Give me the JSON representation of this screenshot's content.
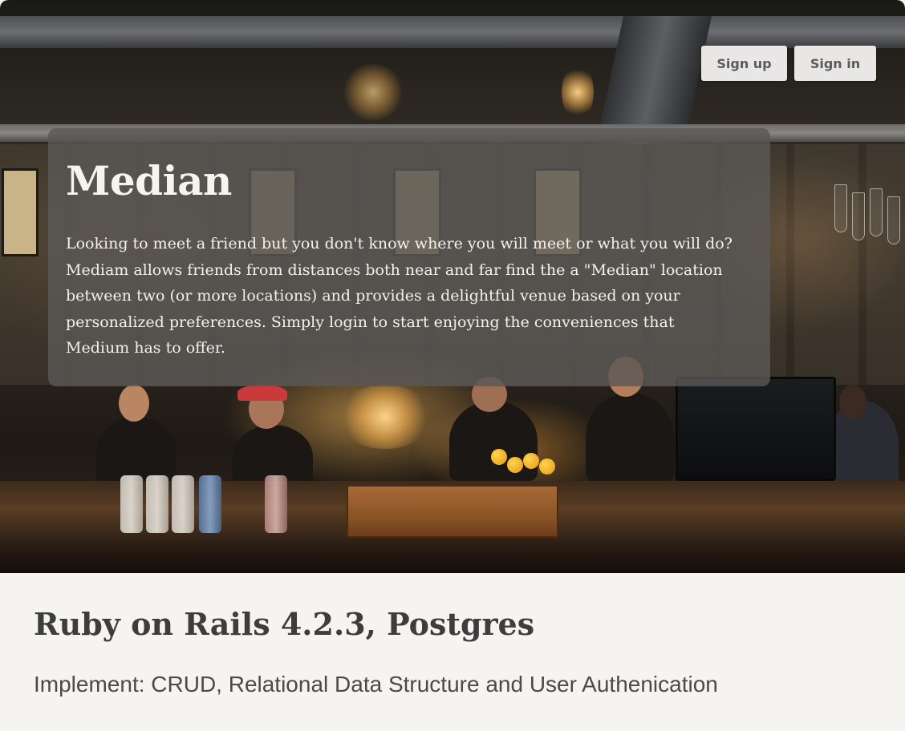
{
  "header": {
    "signup_label": "Sign up",
    "signin_label": "Sign in"
  },
  "hero": {
    "title": "Median",
    "description": "Looking to meet a friend but you don't know where you will meet or what you will do? Mediam allows friends from distances both near and far find the a \"Median\" location between two (or more locations) and provides a delightful venue based on your personalized preferences. Simply login to start enjoying the conveniences that Medium has to offer."
  },
  "caption": {
    "title": "Ruby on Rails 4.2.3, Postgres",
    "subtitle": "Implement: CRUD, Relational Data Structure and User Authenication"
  },
  "colors": {
    "button_bg": "#e8e7e5",
    "button_text": "#5a5b5e",
    "panel_bg": "#5a5855",
    "page_bg": "#f5f4f1",
    "caption_text": "#3d3d3d"
  }
}
